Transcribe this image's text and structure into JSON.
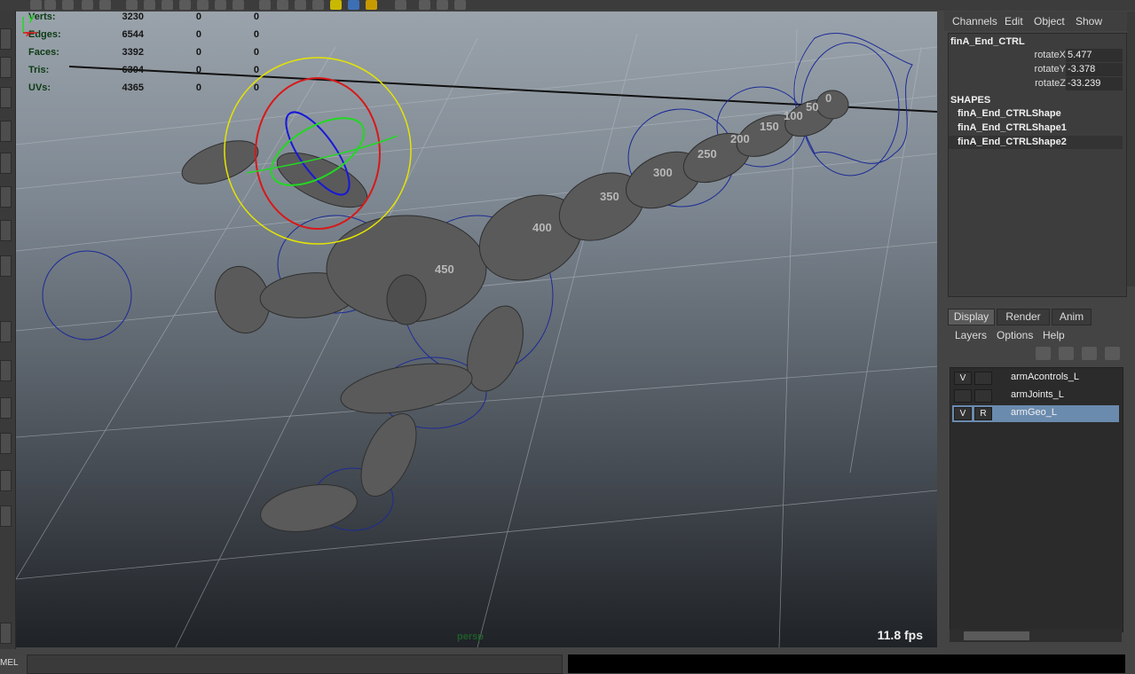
{
  "hud": {
    "rows": [
      {
        "label": "Verts:",
        "v1": "3230",
        "v2": "0",
        "v3": "0"
      },
      {
        "label": "Edges:",
        "v1": "6544",
        "v2": "0",
        "v3": "0"
      },
      {
        "label": "Faces:",
        "v1": "3392",
        "v2": "0",
        "v3": "0"
      },
      {
        "label": "Tris:",
        "v1": "6304",
        "v2": "0",
        "v3": "0"
      },
      {
        "label": "UVs:",
        "v1": "4365",
        "v2": "0",
        "v3": "0"
      }
    ],
    "fps": "11.8 fps",
    "camera": "persp",
    "axis_x": "x",
    "axis_y": "y"
  },
  "viewport_labels": [
    "0",
    "50",
    "100",
    "150",
    "200",
    "250",
    "300",
    "350",
    "400",
    "450"
  ],
  "channel_box": {
    "menu": [
      "Channels",
      "Edit",
      "Object",
      "Show"
    ],
    "object_name": "finA_End_CTRL",
    "attributes": [
      {
        "name": "rotateX",
        "value": "5.477"
      },
      {
        "name": "rotateY",
        "value": "-3.378"
      },
      {
        "name": "rotateZ",
        "value": "-33.239"
      }
    ],
    "shapes_title": "SHAPES",
    "shapes": [
      "finA_End_CTRLShape",
      "finA_End_CTRLShape1",
      "finA_End_CTRLShape2"
    ]
  },
  "layer_editor": {
    "tabs": [
      "Display",
      "Render",
      "Anim"
    ],
    "active_tab": "Display",
    "menu": [
      "Layers",
      "Options",
      "Help"
    ],
    "layers": [
      {
        "visible": "V",
        "ref": "",
        "name": "armAcontrols_L"
      },
      {
        "visible": "",
        "ref": "",
        "name": "armJoints_L"
      },
      {
        "visible": "V",
        "ref": "R",
        "name": "armGeo_L"
      }
    ]
  },
  "bottom": {
    "mel_label": "MEL"
  },
  "colors": {
    "selection": "#6b8bae",
    "panel": "#444444",
    "hud_label": "#0d3a14"
  }
}
